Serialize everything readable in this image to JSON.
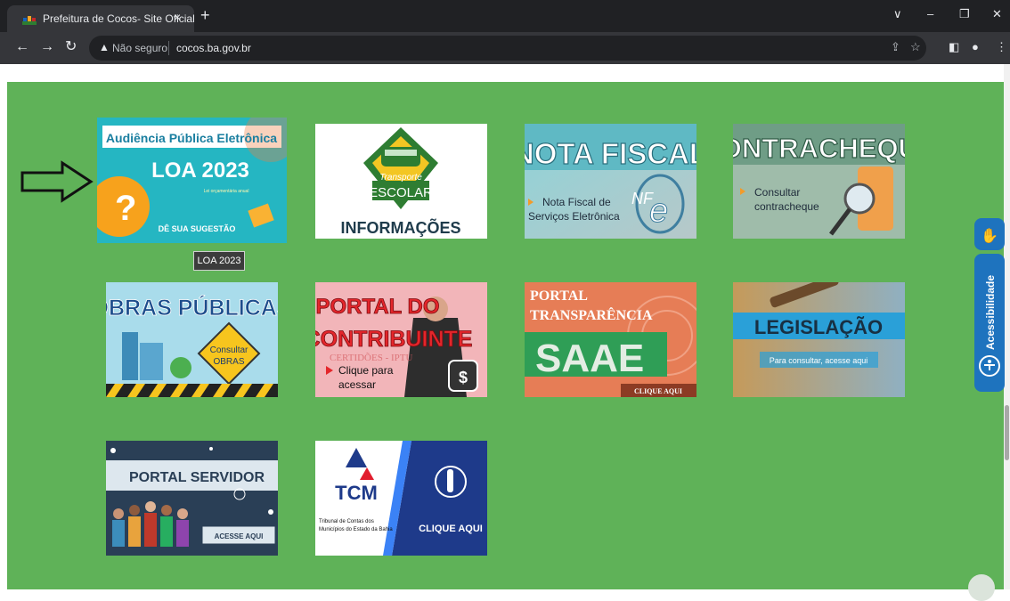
{
  "browser": {
    "tab_title": "Prefeitura de Cocos- Site Oficial",
    "tab_close": "×",
    "new_tab": "+",
    "window_controls": [
      "∨",
      "–",
      "❐",
      "✕"
    ],
    "security_label": "Não seguro",
    "url": "cocos.ba.gov.br",
    "nav_icons": [
      "back-icon",
      "forward-icon",
      "reload-icon"
    ],
    "toolbar_icons": [
      "share-icon",
      "star-icon",
      "sidebar-icon",
      "profile-icon",
      "menu-icon"
    ]
  },
  "banners": [
    {
      "id": "loa",
      "title": "Audiência Pública Eletrônica",
      "main": "LOA 2023",
      "sub": "Lei orçamentária anual",
      "cta": "DÊ SUA SUGESTÃO"
    },
    {
      "id": "transporte",
      "title": "Transporte",
      "main": "ESCOLAR",
      "tag": "ESCOLAR",
      "footer": "INFORMAÇÕES"
    },
    {
      "id": "nota-fiscal",
      "title": "NOTA FISCAL",
      "line1": "Nota Fiscal de",
      "line2": "Serviços Eletrônica",
      "logo": "NF",
      "logo_e": "e"
    },
    {
      "id": "contracheque",
      "title": "CONTRACHEQUE",
      "line1": "Consultar",
      "line2": "contracheque"
    },
    {
      "id": "obras",
      "title": "OBRAS PÚBLICAS",
      "sign1": "Consultar",
      "sign2": "OBRAS"
    },
    {
      "id": "contribuinte",
      "title1": "PORTAL DO",
      "title2": "CONTRIBUINTE",
      "faint": "CERTIDÕES - IPTU",
      "line1": "Clique para",
      "line2": "acessar"
    },
    {
      "id": "saae",
      "title1": "PORTAL",
      "title2": "TRANSPARÊNCIA",
      "main": "SAAE",
      "cta": "CLIQUE AQUI"
    },
    {
      "id": "legislacao",
      "title": "LEGISLAÇÃO",
      "sub": "Para consultar, acesse aqui"
    },
    {
      "id": "servidor",
      "title": "PORTAL SERVIDOR",
      "cta": "ACESSE AQUI"
    },
    {
      "id": "tcm",
      "logo": "TCM",
      "org1": "Tribunal de Contas dos",
      "org2": "Municípios do Estado da Bahia",
      "cta": "CLIQUE AQUI"
    }
  ],
  "tooltip": "LOA 2023",
  "accessibility_label": "Acessibilidade",
  "colors": {
    "page_bg": "#5fb258",
    "chrome_dark": "#202124",
    "chrome_mid": "#35363a",
    "a11y_blue": "#1e73be"
  }
}
